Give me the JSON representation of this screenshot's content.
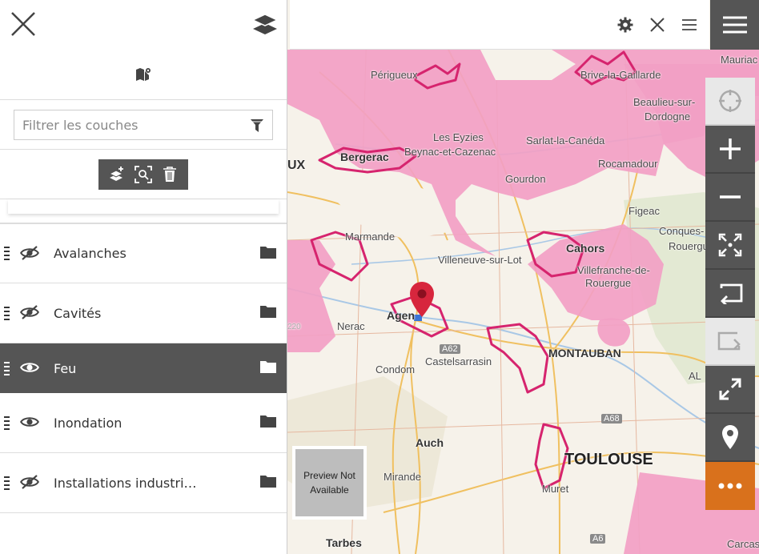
{
  "map": {
    "labels": {
      "perigueux": "Périgueux",
      "brive": "Brive-la-Gaillarde",
      "beaulieu": "Beaulieu-sur-",
      "dordogne": "Dordogne",
      "mauriac": "Mauriac",
      "eyzies": "Les Eyzies",
      "beynac": "Beynac-et-Cazenac",
      "sarlat": "Sarlat-la-Canéda",
      "bergerac": "Bergerac",
      "rocamadour": "Rocamadour",
      "gourdon": "Gourdon",
      "figeac": "Figeac",
      "conques": "Conques-",
      "rouergue_r": "Rouergu",
      "marmande": "Marmande",
      "villeneuve": "Villeneuve-sur-Lot",
      "cahors": "Cahors",
      "villefranche1": "Villefranche-de-",
      "villefranche2": "Rouergue",
      "nerac": "Nerac",
      "agen": "Agen",
      "a62": "A62",
      "castelsarrasin": "Castelsarrasin",
      "montauban": "MONTAUBAN",
      "al": "AL",
      "condom": "Condom",
      "auch": "Auch",
      "toulouse": "TOULOUSE",
      "mirande": "Mirande",
      "muret": "Muret",
      "a68": "A68",
      "a6x": "A6",
      "tarbes": "Tarbes",
      "carca": "Carcas",
      "ux": "UX",
      "a20": "220"
    }
  },
  "preview": {
    "text_line1": "Preview Not",
    "text_line2": "Available"
  },
  "panel": {
    "filter_placeholder": "Filtrer les couches",
    "layers": [
      {
        "name": "Avalanches",
        "visible": false,
        "active": false
      },
      {
        "name": "Cavités",
        "visible": false,
        "active": false
      },
      {
        "name": "Feu",
        "visible": true,
        "active": true
      },
      {
        "name": "Inondation",
        "visible": true,
        "active": false
      },
      {
        "name": "Installations industri…",
        "visible": false,
        "active": false
      }
    ]
  },
  "toolbar_icons": [
    "locate-icon",
    "zoom-in-icon",
    "zoom-out-icon",
    "zoom-extent-icon",
    "previous-view-icon",
    "next-view-icon",
    "fullscreen-icon",
    "marker-icon",
    "more-icon"
  ],
  "colors": {
    "risk_pink": "#f2a0c4",
    "risk_border": "#d6246e",
    "toolbar_dark": "#555555",
    "toolbar_orange": "#d9711c"
  }
}
